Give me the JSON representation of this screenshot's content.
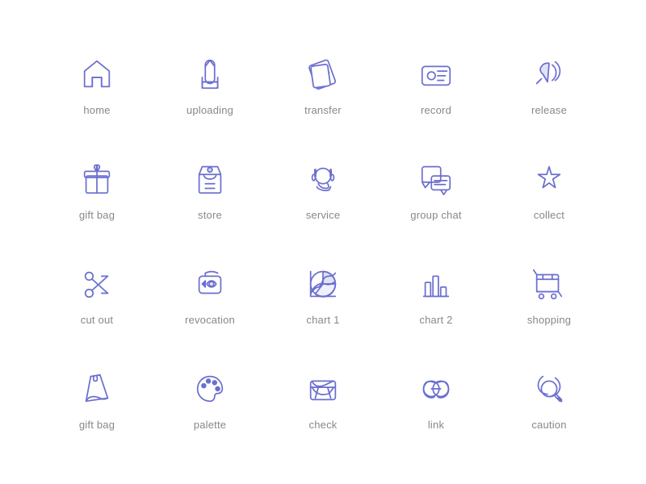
{
  "icons": [
    {
      "id": "home",
      "label": "home"
    },
    {
      "id": "uploading",
      "label": "uploading"
    },
    {
      "id": "transfer",
      "label": "transfer"
    },
    {
      "id": "record",
      "label": "record"
    },
    {
      "id": "release",
      "label": "release"
    },
    {
      "id": "gift-bag-1",
      "label": "gift bag"
    },
    {
      "id": "store",
      "label": "store"
    },
    {
      "id": "service",
      "label": "service"
    },
    {
      "id": "group-chat",
      "label": "group chat"
    },
    {
      "id": "collect",
      "label": "collect"
    },
    {
      "id": "cut-out",
      "label": "cut out"
    },
    {
      "id": "revocation",
      "label": "revocation"
    },
    {
      "id": "chart-1",
      "label": "chart 1"
    },
    {
      "id": "chart-2",
      "label": "chart 2"
    },
    {
      "id": "shopping",
      "label": "shopping"
    },
    {
      "id": "gift-bag-2",
      "label": "gift bag"
    },
    {
      "id": "palette",
      "label": "palette"
    },
    {
      "id": "check",
      "label": "check"
    },
    {
      "id": "link",
      "label": "link"
    },
    {
      "id": "caution",
      "label": "caution"
    }
  ]
}
